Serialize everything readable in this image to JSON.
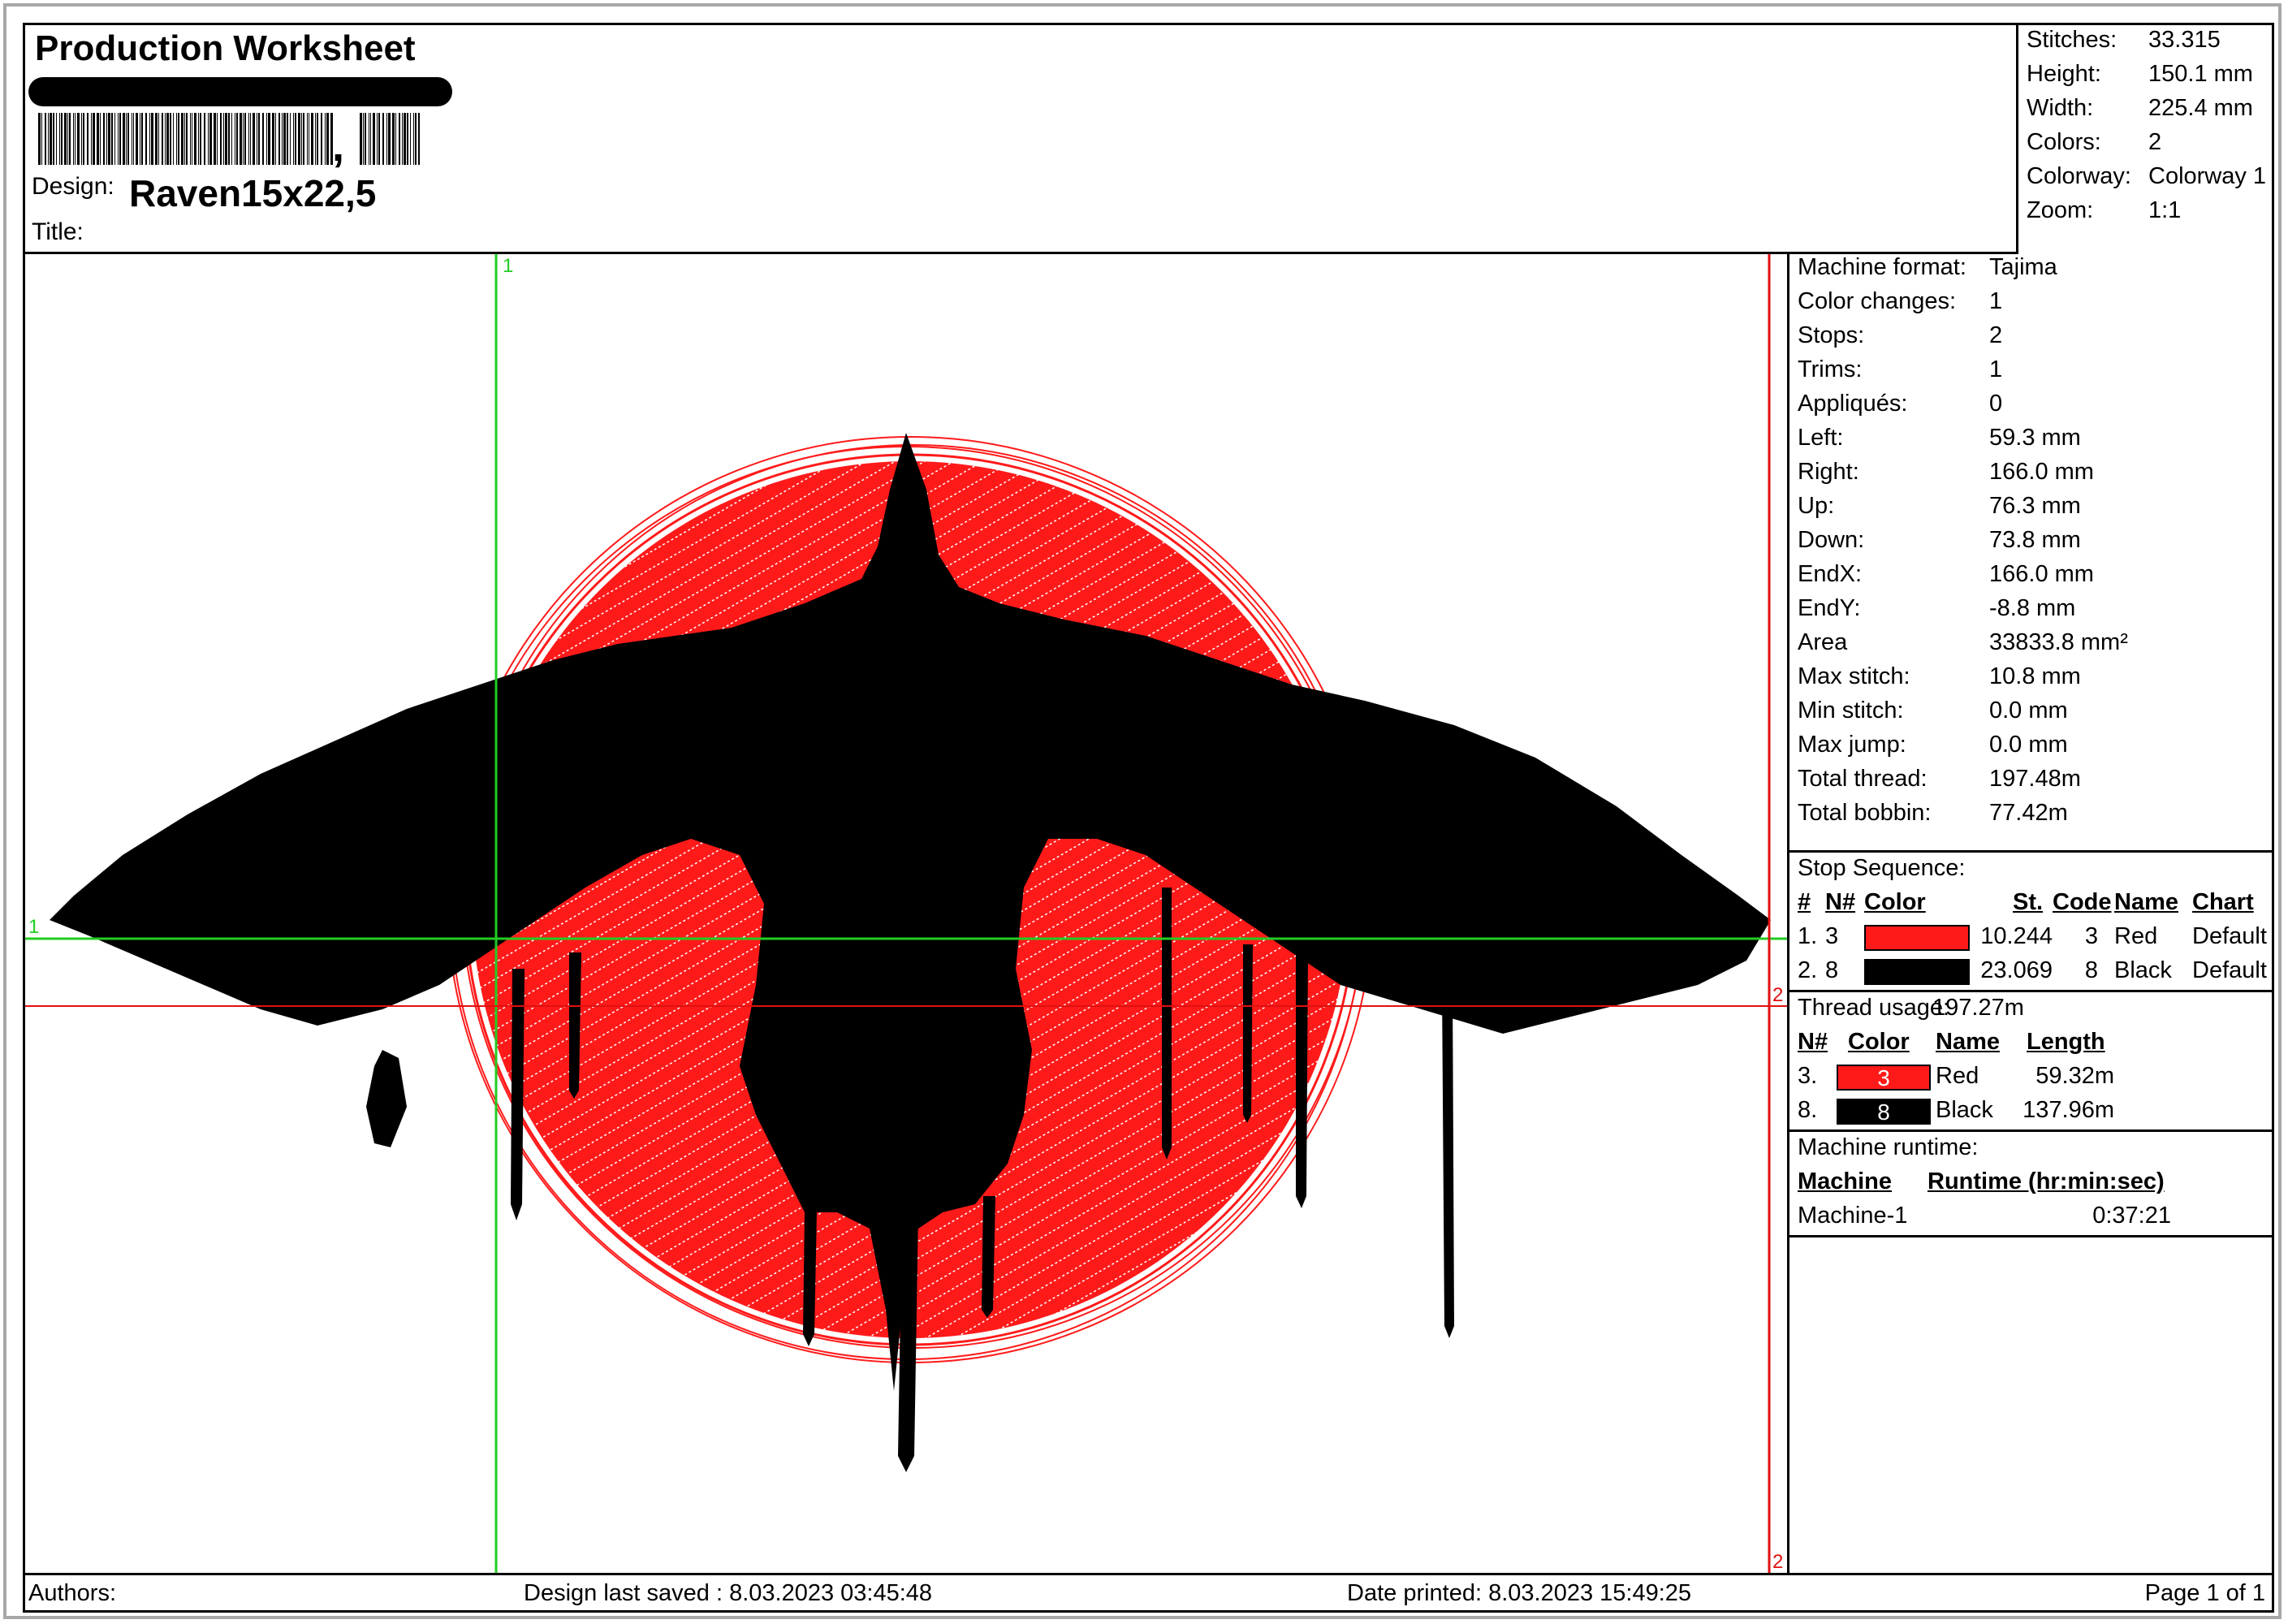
{
  "header": {
    "title": "Production Worksheet",
    "design_label": "Design:",
    "design_value": "Raven15x22,5",
    "title_label": "Title:"
  },
  "summary": [
    {
      "k": "Stitches:",
      "v": "33.315"
    },
    {
      "k": "Height:",
      "v": "150.1 mm"
    },
    {
      "k": "Width:",
      "v": "225.4 mm"
    },
    {
      "k": "Colors:",
      "v": "2"
    },
    {
      "k": "Colorway:",
      "v": "Colorway 1"
    },
    {
      "k": "Zoom:",
      "v": "1:1"
    }
  ],
  "stats": [
    {
      "k": "Machine format:",
      "v": "Tajima"
    },
    {
      "k": "Color changes:",
      "v": "1"
    },
    {
      "k": "Stops:",
      "v": "2"
    },
    {
      "k": "Trims:",
      "v": "1"
    },
    {
      "k": "Appliqués:",
      "v": "0"
    },
    {
      "k": "Left:",
      "v": "59.3 mm"
    },
    {
      "k": "Right:",
      "v": "166.0 mm"
    },
    {
      "k": "Up:",
      "v": "76.3 mm"
    },
    {
      "k": "Down:",
      "v": "73.8 mm"
    },
    {
      "k": "EndX:",
      "v": "166.0 mm"
    },
    {
      "k": "EndY:",
      "v": "-8.8 mm"
    },
    {
      "k": "Area",
      "v": "33833.8 mm²"
    },
    {
      "k": "Max stitch:",
      "v": "10.8 mm"
    },
    {
      "k": "Min stitch:",
      "v": "0.0 mm"
    },
    {
      "k": "Max jump:",
      "v": "0.0 mm"
    },
    {
      "k": "Total thread:",
      "v": "197.48m"
    },
    {
      "k": "Total bobbin:",
      "v": "77.42m"
    }
  ],
  "stop_sequence": {
    "title": "Stop Sequence:",
    "headers": {
      "num": "#",
      "needle": "N#",
      "color": "Color",
      "stitches": "St.",
      "code": "Code",
      "name": "Name",
      "chart": "Chart"
    },
    "rows": [
      {
        "num": "1.",
        "needle": "3",
        "color": "#ff1a1a",
        "stitches": "10.244",
        "code": "3",
        "name": "Red",
        "chart": "Default"
      },
      {
        "num": "2.",
        "needle": "8",
        "color": "#000000",
        "stitches": "23.069",
        "code": "8",
        "name": "Black",
        "chart": "Default"
      }
    ]
  },
  "thread_usage": {
    "label": "Thread usage:",
    "total": "197.27m",
    "headers": {
      "needle": "N#",
      "color": "Color",
      "name": "Name",
      "length": "Length"
    },
    "rows": [
      {
        "needle": "3.",
        "swatch_num": "3",
        "color": "#ff1a1a",
        "name": "Red",
        "length": "59.32m"
      },
      {
        "needle": "8.",
        "swatch_num": "8",
        "color": "#000000",
        "name": "Black",
        "length": "137.96m"
      }
    ]
  },
  "runtime": {
    "title": "Machine runtime:",
    "headers": {
      "machine": "Machine",
      "runtime": "Runtime (hr:min:sec)"
    },
    "rows": [
      {
        "machine": "Machine-1",
        "runtime": "0:37:21"
      }
    ]
  },
  "canvas": {
    "marker_green_v": "1",
    "marker_green_h": "1",
    "marker_red_h": "2",
    "marker_red_v": "2"
  },
  "footer": {
    "authors": "Authors:",
    "last_saved": "Design last saved : 8.03.2023 03:45:48",
    "printed": "Date printed: 8.03.2023 15:49:25",
    "page": "Page 1 of 1"
  }
}
